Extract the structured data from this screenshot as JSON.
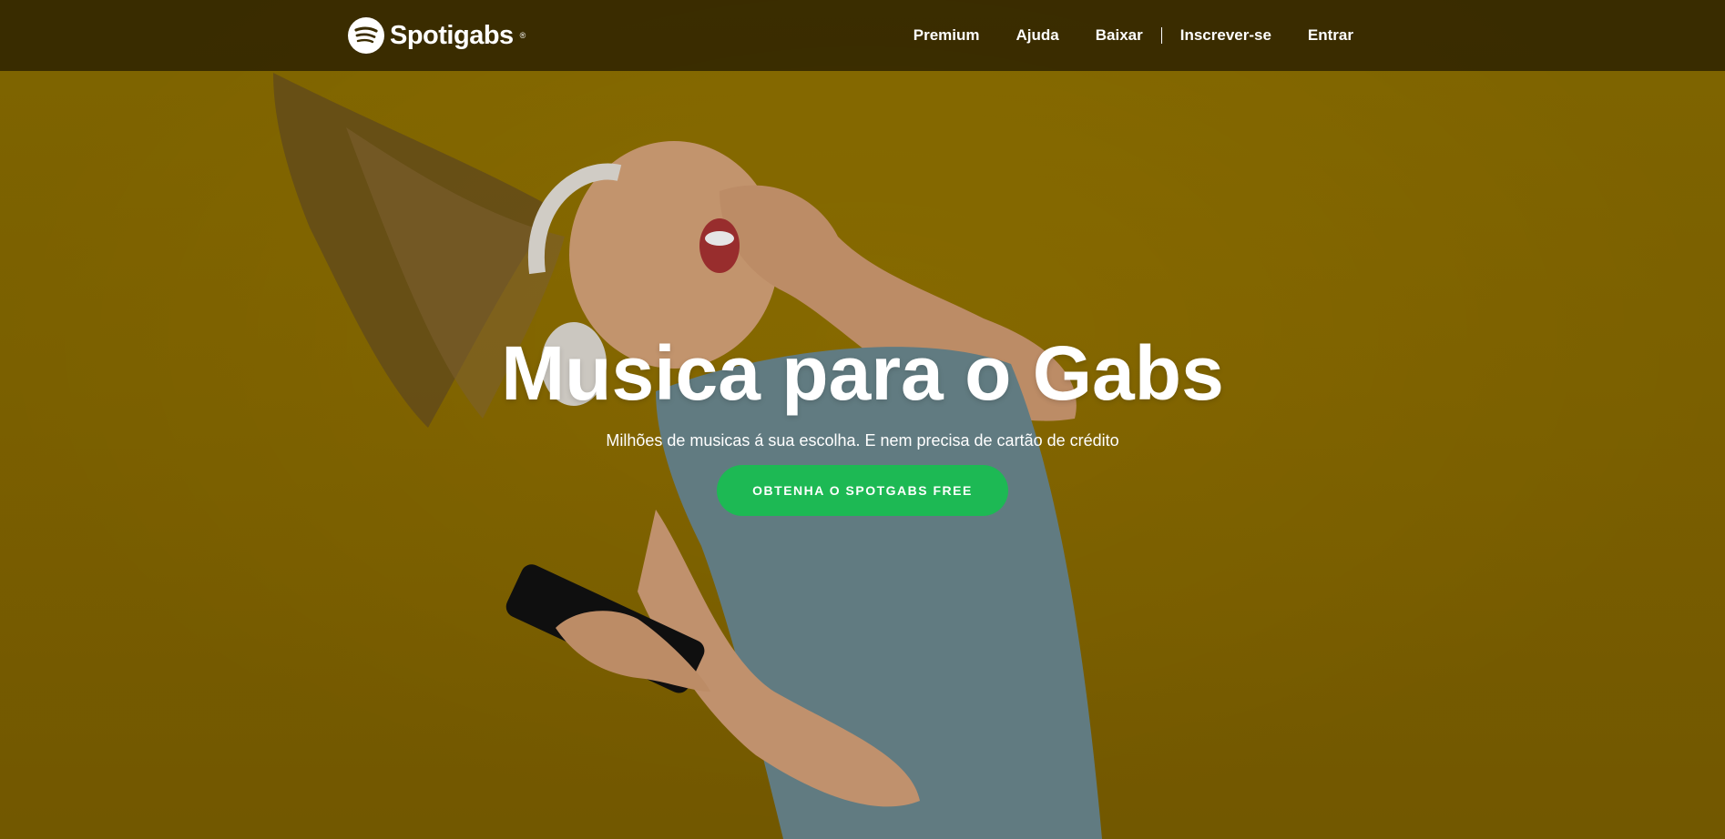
{
  "brand": {
    "name": "Spotigabs",
    "tm": "®",
    "logo_icon": "spotify-icon"
  },
  "nav": {
    "links": [
      "Premium",
      "Ajuda",
      "Baixar"
    ],
    "auth_links": [
      "Inscrever-se",
      "Entrar"
    ]
  },
  "hero": {
    "title": "Musica para o Gabs",
    "subtitle": "Milhões de musicas á sua escolha. E nem precisa de cartão de crédito",
    "cta_label": "OBTENHA O SPOTGABS FREE"
  },
  "colors": {
    "background": "#957400",
    "navbar": "#1e1600",
    "accent": "#1db954",
    "text": "#ffffff"
  }
}
